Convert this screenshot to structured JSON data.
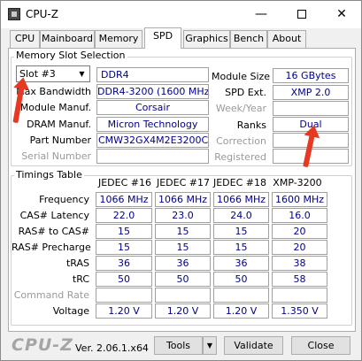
{
  "window": {
    "title": "CPU-Z",
    "minimize_glyph": "—",
    "close_glyph": "✕"
  },
  "tabs": [
    "CPU",
    "Mainboard",
    "Memory",
    "SPD",
    "Graphics",
    "Bench",
    "About"
  ],
  "active_tab": "SPD",
  "memory_slot": {
    "legend": "Memory Slot Selection",
    "slot_selected": "Slot #3",
    "type": "DDR4",
    "rows_left": [
      {
        "label": "Max Bandwidth",
        "value": "DDR4-3200 (1600 MHz)"
      },
      {
        "label": "Module Manuf.",
        "value": "Corsair"
      },
      {
        "label": "DRAM Manuf.",
        "value": "Micron Technology"
      },
      {
        "label": "Part Number",
        "value": "CMW32GX4M2E3200C16"
      },
      {
        "label": "Serial Number",
        "value": ""
      }
    ],
    "rows_right": [
      {
        "label": "Module Size",
        "value": "16 GBytes"
      },
      {
        "label": "SPD Ext.",
        "value": "XMP 2.0"
      },
      {
        "label": "Week/Year",
        "value": ""
      },
      {
        "label": "Ranks",
        "value": "Dual"
      },
      {
        "label": "Correction",
        "value": ""
      },
      {
        "label": "Registered",
        "value": ""
      }
    ]
  },
  "timings": {
    "legend": "Timings Table",
    "columns": [
      "JEDEC #16",
      "JEDEC #17",
      "JEDEC #18",
      "XMP-3200"
    ],
    "rows": [
      {
        "label": "Frequency",
        "values": [
          "1066 MHz",
          "1066 MHz",
          "1066 MHz",
          "1600 MHz"
        ]
      },
      {
        "label": "CAS# Latency",
        "values": [
          "22.0",
          "23.0",
          "24.0",
          "16.0"
        ]
      },
      {
        "label": "RAS# to CAS#",
        "values": [
          "15",
          "15",
          "15",
          "20"
        ]
      },
      {
        "label": "RAS# Precharge",
        "values": [
          "15",
          "15",
          "15",
          "20"
        ]
      },
      {
        "label": "tRAS",
        "values": [
          "36",
          "36",
          "36",
          "38"
        ]
      },
      {
        "label": "tRC",
        "values": [
          "50",
          "50",
          "50",
          "58"
        ]
      },
      {
        "label": "Command Rate",
        "values": [
          "",
          "",
          "",
          ""
        ]
      },
      {
        "label": "Voltage",
        "values": [
          "1.20 V",
          "1.20 V",
          "1.20 V",
          "1.350 V"
        ]
      }
    ]
  },
  "footer": {
    "brand": "CPU-Z",
    "version": "Ver. 2.06.1.x64",
    "tools_label": "Tools",
    "validate_label": "Validate",
    "close_label": "Close"
  },
  "annotation_color": "#e53922"
}
